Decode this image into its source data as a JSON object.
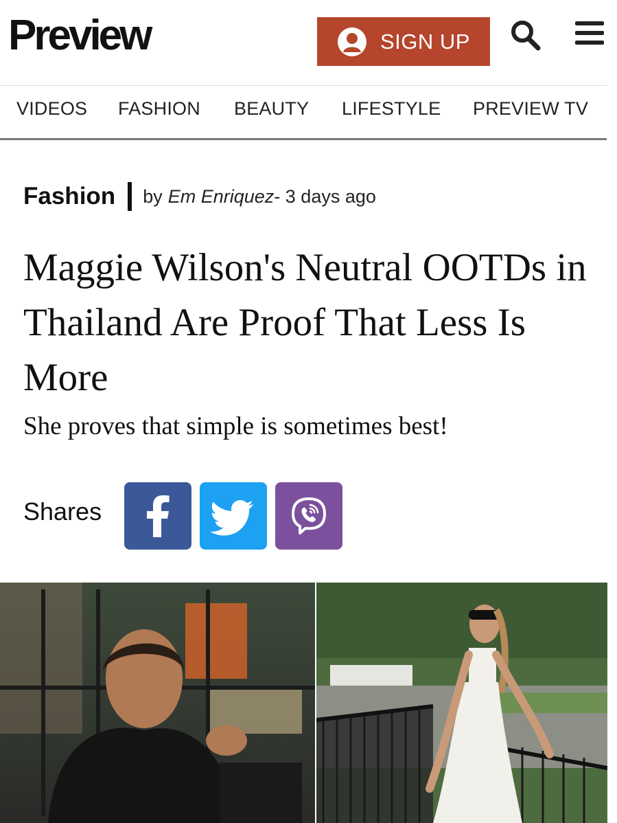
{
  "header": {
    "logo": "Preview",
    "signup_label": "SIGN UP"
  },
  "nav": {
    "items": [
      {
        "label": "VIDEOS"
      },
      {
        "label": "FASHION"
      },
      {
        "label": "BEAUTY"
      },
      {
        "label": "LIFESTYLE"
      },
      {
        "label": "PREVIEW TV"
      }
    ]
  },
  "article": {
    "category": "Fashion",
    "by": "by",
    "author": "Em Enriquez",
    "date": "- 3 days ago",
    "headline": "Maggie Wilson's Neutral OOTDs in Thailand Are Proof That Less Is More",
    "dek": "She proves that simple is sometimes best!"
  },
  "shares": {
    "label": "Shares",
    "buttons": [
      {
        "icon": "facebook-icon",
        "color": "#3b5998"
      },
      {
        "icon": "twitter-icon",
        "color": "#1da1f2"
      },
      {
        "icon": "viber-icon",
        "color": "#7b519d"
      }
    ]
  },
  "colors": {
    "signup_bg": "#b5452c",
    "text": "#111111"
  }
}
